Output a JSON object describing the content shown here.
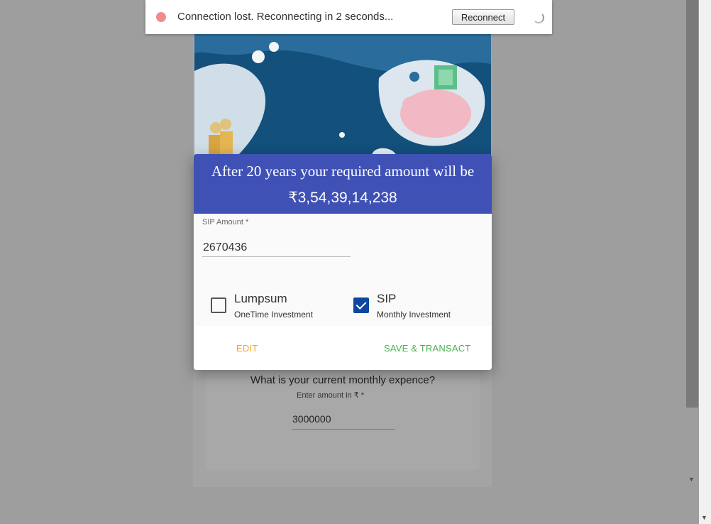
{
  "banner": {
    "message": "Connection lost. Reconnecting in 2 seconds...",
    "reconnect_label": "Reconnect",
    "dot_color": "#f08c8c"
  },
  "dialog": {
    "title": "After 20 years your required amount will be",
    "amount": "₹3,54,39,14,238",
    "header_color": "#3f51b5",
    "sip_amount_label": "SIP Amount *",
    "sip_amount_value": "2670436",
    "options": [
      {
        "title": "Lumpsum",
        "subtitle": "OneTime Investment",
        "checked": false
      },
      {
        "title": "SIP",
        "subtitle": "Monthly Investment",
        "checked": true
      }
    ],
    "edit_label": "EDIT",
    "edit_color": "#f5a623",
    "save_label": "SAVE & TRANSACT",
    "save_color": "#4caf50"
  },
  "background": {
    "question": "What is your current monthly expence?",
    "amount_label": "Enter amount in ₹ *",
    "amount_value": "3000000"
  }
}
